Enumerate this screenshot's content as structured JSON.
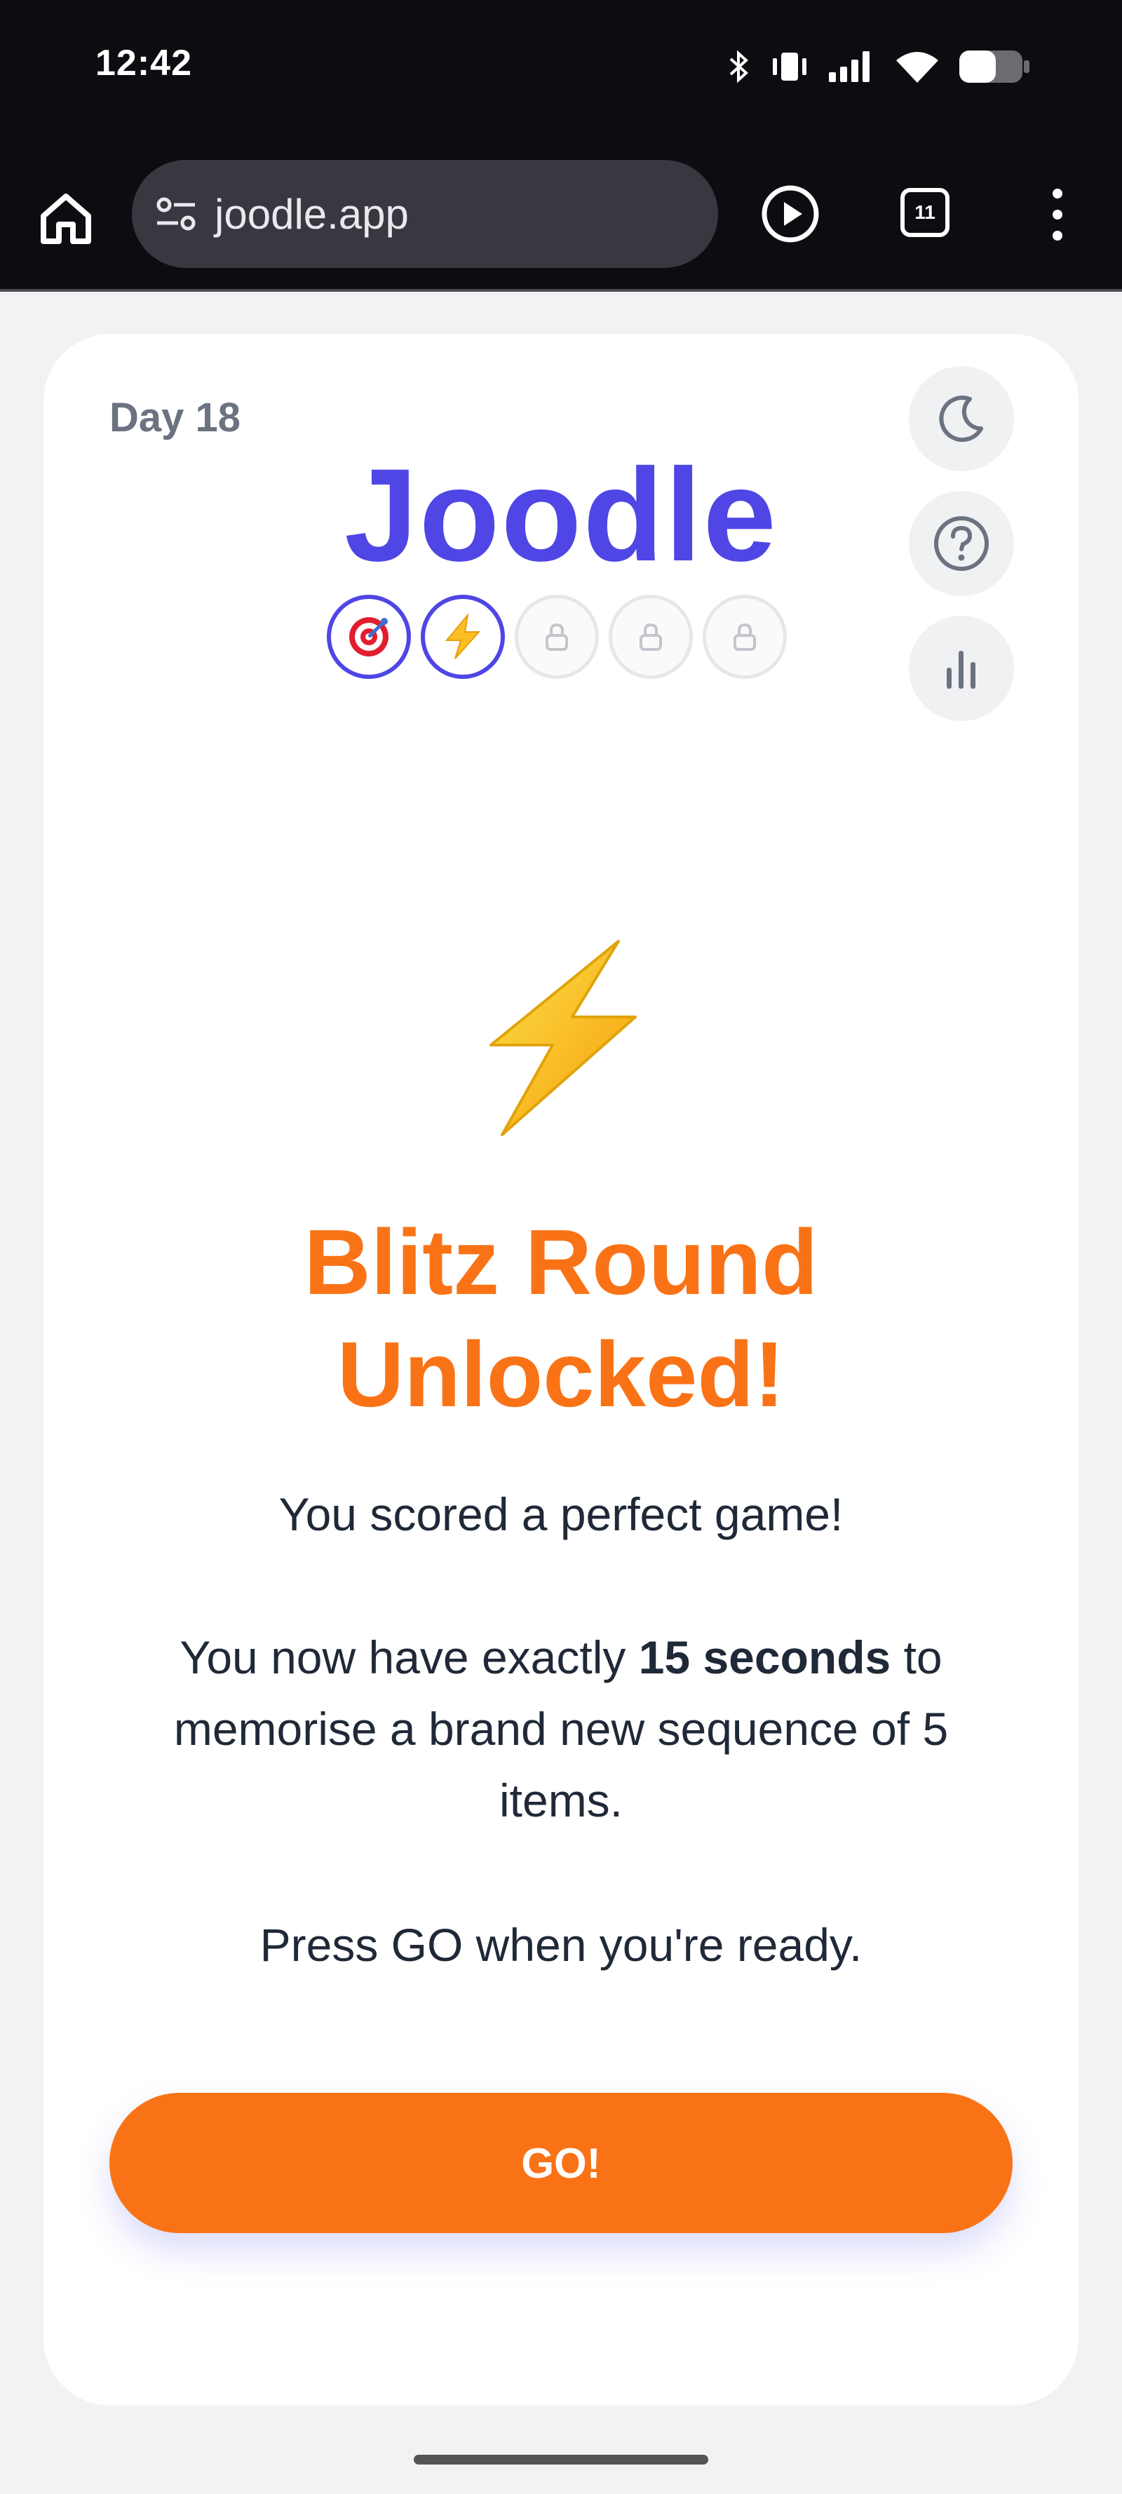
{
  "status_bar": {
    "time": "12:42"
  },
  "browser": {
    "url": "joodle.app",
    "tab_count": "11"
  },
  "game": {
    "day_label": "Day 18",
    "logo": "Joodle",
    "headline_line1": "Blitz Round",
    "headline_line2": "Unlocked!",
    "message1": "You scored a perfect game!",
    "message2_before": "You now have exactly ",
    "message2_bold": "15 seconds",
    "message2_after": " to memorise a brand new sequence of 5 items.",
    "message3": "Press GO when you're ready.",
    "go_label": "GO!",
    "rounds": [
      {
        "icon": "target-icon",
        "state": "completed"
      },
      {
        "icon": "lightning-icon",
        "state": "completed"
      },
      {
        "icon": "lock-icon",
        "state": "locked"
      },
      {
        "icon": "lock-icon",
        "state": "locked"
      },
      {
        "icon": "lock-icon",
        "state": "locked"
      }
    ]
  },
  "colors": {
    "brand": "#4f46e5",
    "accent": "#f97316"
  }
}
